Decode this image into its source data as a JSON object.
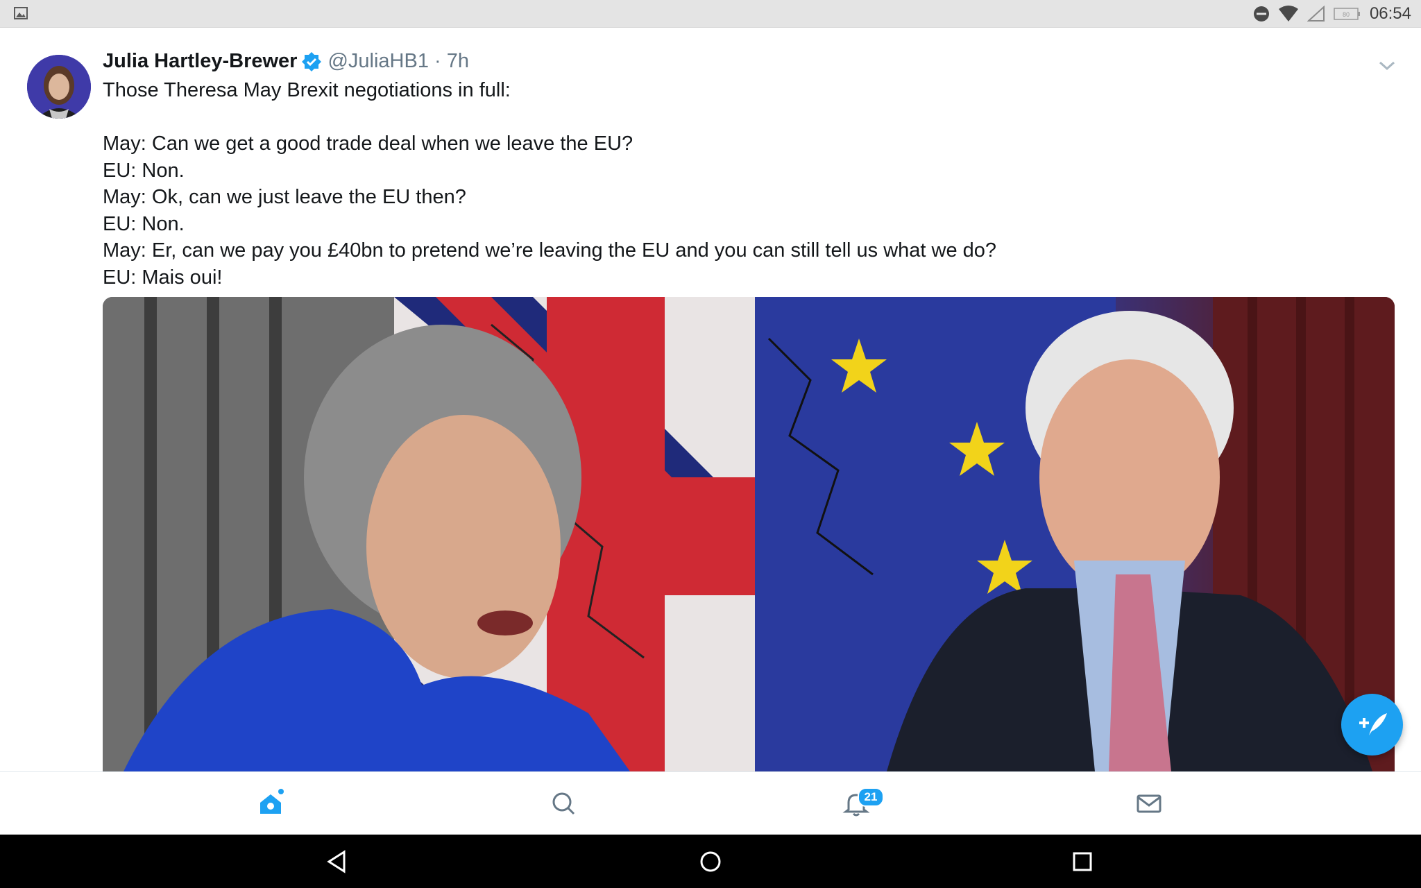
{
  "status_bar": {
    "time": "06:54",
    "battery_level": "80",
    "icons": [
      "gallery-icon",
      "do-not-disturb-icon",
      "wifi-icon",
      "cell-signal-icon",
      "battery-icon"
    ]
  },
  "tweet": {
    "author_name": "Julia Hartley-Brewer",
    "handle_time": "@JuliaHB1 · 7h",
    "verified": true,
    "text_lines": [
      "Those Theresa May Brexit negotiations in full:",
      "",
      "May: Can we get a good trade deal when we leave the EU?",
      "EU: Non.",
      "May: Ok, can we just leave the EU then?",
      "EU: Non.",
      "May: Er, can we pay you £40bn to pretend we’re leaving the EU and you can still tell us what we do?",
      "EU: Mais oui!"
    ]
  },
  "bottom_nav": {
    "items": [
      {
        "name": "home",
        "icon": "home-icon",
        "active": true
      },
      {
        "name": "search",
        "icon": "search-icon",
        "active": false
      },
      {
        "name": "notifications",
        "icon": "bell-icon",
        "active": false,
        "badge": "21"
      },
      {
        "name": "messages",
        "icon": "mail-icon",
        "active": false
      }
    ]
  },
  "colors": {
    "accent": "#1da1f2",
    "secondary_text": "#657786",
    "status_bar_bg": "#e4e4e4",
    "system_nav_bg": "#000000"
  },
  "system_nav": {
    "icons": [
      "back-icon",
      "home-circle-icon",
      "recents-icon"
    ]
  }
}
